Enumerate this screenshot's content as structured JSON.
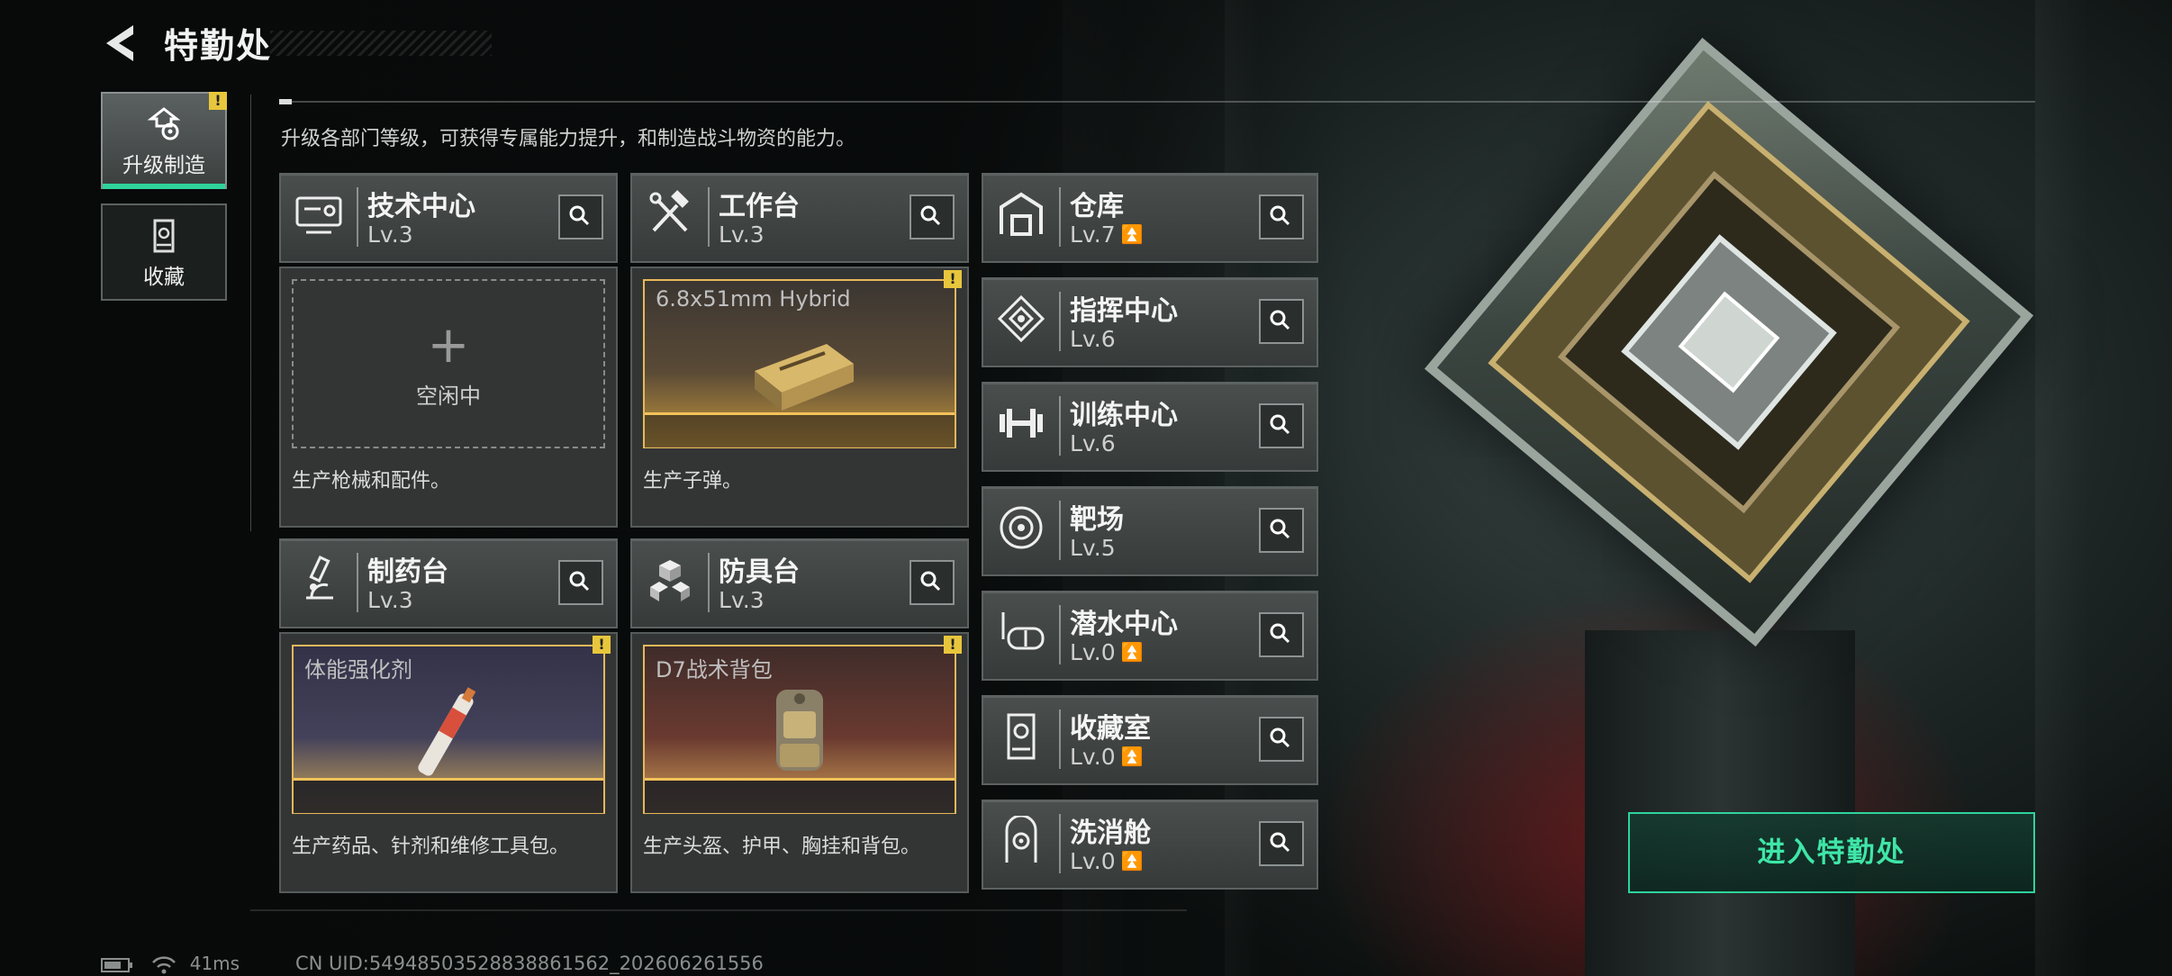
{
  "header": {
    "title": "特勤处"
  },
  "description": "升级各部门等级，可获得专属能力提升，和制造战斗物资的能力。",
  "side_tabs": [
    {
      "label": "升级制造",
      "active": true,
      "alert": "!"
    },
    {
      "label": "收藏",
      "active": false
    }
  ],
  "production": [
    {
      "name": "技术中心",
      "level": "Lv.3",
      "state": "空闲中",
      "item": "",
      "description": "生产枪械和配件。"
    },
    {
      "name": "工作台",
      "level": "Lv.3",
      "item": "6.8x51mm Hybrid",
      "alert": "!",
      "description": "生产子弹。"
    },
    {
      "name": "制药台",
      "level": "Lv.3",
      "item": "体能强化剂",
      "alert": "!",
      "description": "生产药品、针剂和维修工具包。"
    },
    {
      "name": "防具台",
      "level": "Lv.3",
      "item": "D7战术背包",
      "alert": "!",
      "description": "生产头盔、护甲、胸挂和背包。"
    }
  ],
  "facilities": [
    {
      "name": "仓库",
      "level": "Lv.7",
      "upgradable": true
    },
    {
      "name": "指挥中心",
      "level": "Lv.6",
      "upgradable": false
    },
    {
      "name": "训练中心",
      "level": "Lv.6",
      "upgradable": false
    },
    {
      "name": "靶场",
      "level": "Lv.5",
      "upgradable": false
    },
    {
      "name": "潜水中心",
      "level": "Lv.0",
      "upgradable": true
    },
    {
      "name": "收藏室",
      "level": "Lv.0",
      "upgradable": true
    },
    {
      "name": "洗消舱",
      "level": "Lv.0",
      "upgradable": true
    }
  ],
  "enter_button": "进入特勤处",
  "status_bar": {
    "ping": "41ms",
    "uid": "CN UID:5494850352883886156​2_202606261556"
  },
  "colors": {
    "accent": "#2fd39b",
    "alert": "#e8c63c",
    "item_border": "#e6b85a"
  }
}
